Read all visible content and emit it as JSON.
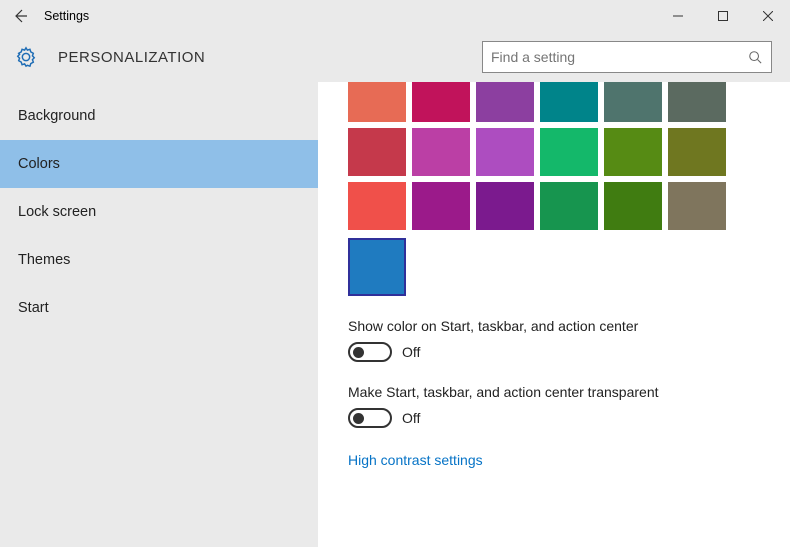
{
  "window": {
    "title": "Settings"
  },
  "header": {
    "category": "PERSONALIZATION",
    "search_placeholder": "Find a setting"
  },
  "sidebar": {
    "items": [
      {
        "label": "Background",
        "selected": false
      },
      {
        "label": "Colors",
        "selected": true
      },
      {
        "label": "Lock screen",
        "selected": false
      },
      {
        "label": "Themes",
        "selected": false
      },
      {
        "label": "Start",
        "selected": false
      }
    ]
  },
  "colors": {
    "rows": [
      [
        "#e76b55",
        "#c1135b",
        "#8c3fa0",
        "#00848a",
        "#4f746d",
        "#5b6a60"
      ],
      [
        "#c5394b",
        "#bb3fa5",
        "#ad4dc0",
        "#14b86a",
        "#568b14",
        "#6f7720"
      ],
      [
        "#f0504a",
        "#9b1a8a",
        "#7b1a8e",
        "#17954f",
        "#407c11",
        "#7f755d"
      ]
    ],
    "selected": "#1f7bc0"
  },
  "settings": {
    "show_color": {
      "label": "Show color on Start, taskbar, and action center",
      "state": "Off"
    },
    "transparent": {
      "label": "Make Start, taskbar, and action center transparent",
      "state": "Off"
    },
    "link": "High contrast settings"
  }
}
